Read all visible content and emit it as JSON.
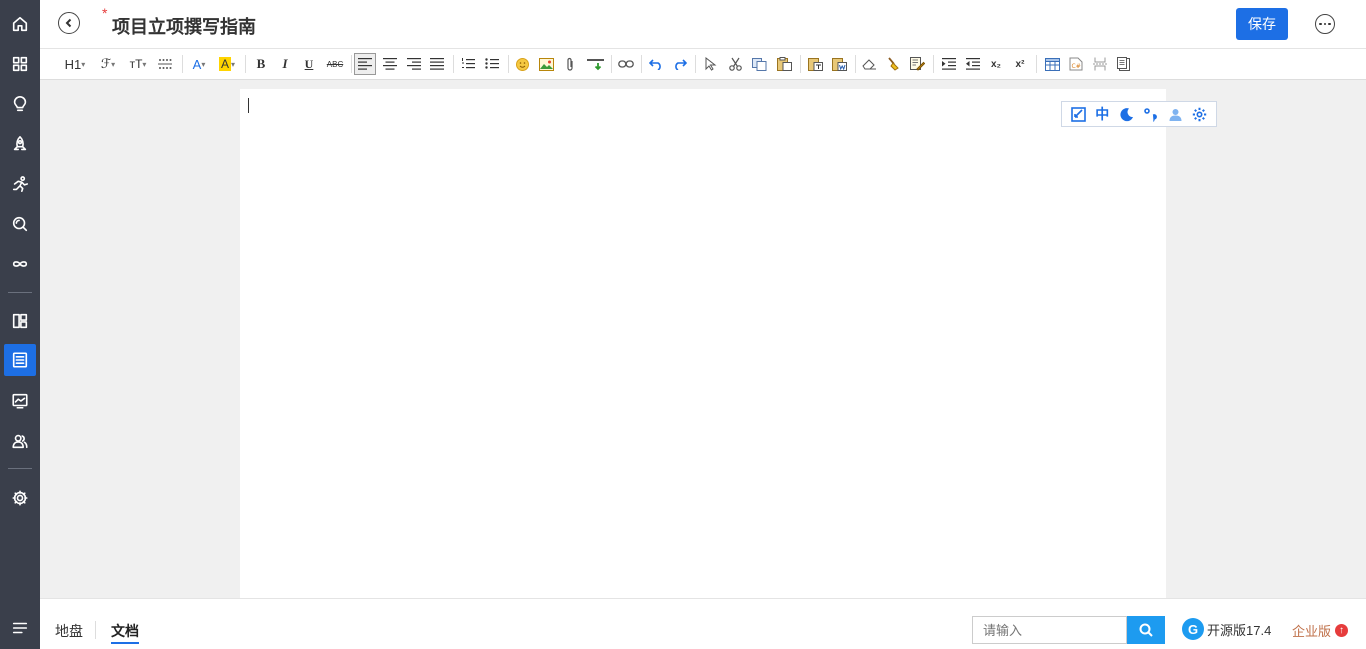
{
  "header": {
    "required_mark": "*",
    "title": "项目立项撰写指南",
    "save_label": "保存"
  },
  "sidebar": {
    "items": [
      {
        "icon": "home-icon"
      },
      {
        "icon": "apps-icon"
      },
      {
        "icon": "lightbulb-icon"
      },
      {
        "icon": "rocket-icon"
      },
      {
        "icon": "running-icon"
      },
      {
        "icon": "search-quality-icon"
      },
      {
        "icon": "infinity-icon"
      },
      {
        "icon": "board-icon"
      },
      {
        "icon": "document-list-icon",
        "active": true
      },
      {
        "icon": "monitor-icon"
      },
      {
        "icon": "team-icon"
      },
      {
        "icon": "settings-icon"
      }
    ]
  },
  "toolbar": {
    "heading_label": "H1",
    "font_label": "ℱ",
    "size_label": "тT",
    "dropdown_arrow": "▾",
    "font_color_label": "A",
    "highlight_label": "A",
    "bold_label": "B",
    "italic_label": "I",
    "underline_label": "U",
    "strike_label": "ABC",
    "subscript_label": "x₂",
    "superscript_label": "x²"
  },
  "float_tools": {
    "lang_label": "中"
  },
  "bottom": {
    "tabs": [
      {
        "label": "地盘",
        "active": false
      },
      {
        "label": "文档",
        "active": true
      }
    ],
    "search_placeholder": "请输入",
    "version_label": "开源版17.4",
    "enterprise_label": "企业版"
  },
  "colors": {
    "sidebar_bg": "#3a3f4b",
    "accent": "#1d6fe5",
    "search_button": "#1d9bf0",
    "required": "#e63c3c",
    "enterprise": "#c0714a"
  }
}
